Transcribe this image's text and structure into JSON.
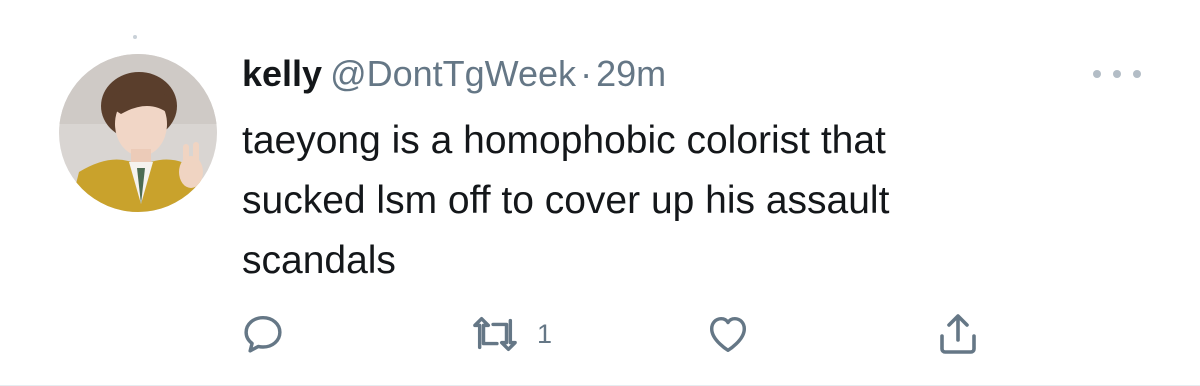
{
  "tweet": {
    "display_name": "kelly",
    "handle": "@DontTgWeek",
    "separator": "·",
    "time": "29m",
    "text": "taeyong is a homophobic colorist that\nsucked lsm off to cover up his assault\nscandals",
    "actions": {
      "reply_icon": "comment-bubble-icon",
      "retweet_icon": "retweet-icon",
      "retweet_count": "1",
      "like_icon": "heart-icon",
      "share_icon": "share-upload-icon",
      "more_icon": "ellipsis-icon"
    }
  },
  "colors": {
    "name_text": "#14171a",
    "secondary_text": "#657786",
    "icon": "#657786",
    "divider": "#e6ecf0"
  }
}
